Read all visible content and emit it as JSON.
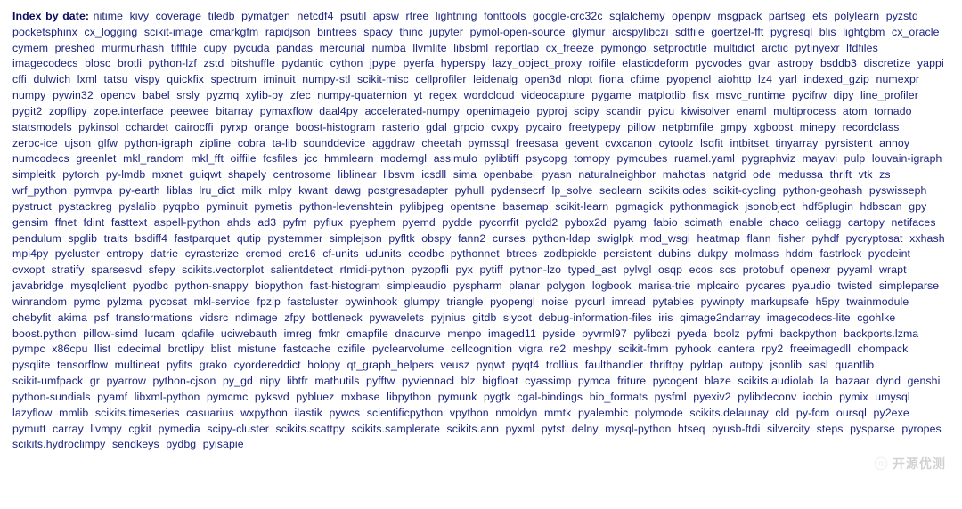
{
  "heading": "Index by date:",
  "packages": [
    "nitime",
    "kivy",
    "coverage",
    "tiledb",
    "pymatgen",
    "netcdf4",
    "psutil",
    "apsw",
    "rtree",
    "lightning",
    "fonttools",
    "google-crc32c",
    "sqlalchemy",
    "openpiv",
    "msgpack",
    "partseg",
    "ets",
    "polylearn",
    "pyzstd",
    "pocketsphinx",
    "cx_logging",
    "scikit-image",
    "cmarkgfm",
    "rapidjson",
    "bintrees",
    "spacy",
    "thinc",
    "jupyter",
    "pymol-open-source",
    "glymur",
    "aicspylibczi",
    "sdtfile",
    "goertzel-fft",
    "pygresql",
    "blis",
    "lightgbm",
    "cx_oracle",
    "cymem",
    "preshed",
    "murmurhash",
    "tifffile",
    "cupy",
    "pycuda",
    "pandas",
    "mercurial",
    "numba",
    "llvmlite",
    "libsbml",
    "reportlab",
    "cx_freeze",
    "pymongo",
    "setproctitle",
    "multidict",
    "arctic",
    "pytinyexr",
    "lfdfiles",
    "imagecodecs",
    "blosc",
    "brotli",
    "python-lzf",
    "zstd",
    "bitshuffle",
    "pydantic",
    "cython",
    "jpype",
    "pyerfa",
    "hyperspy",
    "lazy_object_proxy",
    "roifile",
    "elasticdeform",
    "pycvodes",
    "gvar",
    "astropy",
    "bsddb3",
    "discretize",
    "yappi",
    "cffi",
    "dulwich",
    "lxml",
    "tatsu",
    "vispy",
    "quickfix",
    "spectrum",
    "iminuit",
    "numpy-stl",
    "scikit-misc",
    "cellprofiler",
    "leidenalg",
    "open3d",
    "nlopt",
    "fiona",
    "cftime",
    "pyopencl",
    "aiohttp",
    "lz4",
    "yarl",
    "indexed_gzip",
    "numexpr",
    "numpy",
    "pywin32",
    "opencv",
    "babel",
    "srsly",
    "pyzmq",
    "xylib-py",
    "zfec",
    "numpy-quaternion",
    "yt",
    "regex",
    "wordcloud",
    "videocapture",
    "pygame",
    "matplotlib",
    "fisx",
    "msvc_runtime",
    "pycifrw",
    "dipy",
    "line_profiler",
    "pygit2",
    "zopflipy",
    "zope.interface",
    "peewee",
    "bitarray",
    "pymaxflow",
    "daal4py",
    "accelerated-numpy",
    "openimageio",
    "pyproj",
    "scipy",
    "scandir",
    "pyicu",
    "kiwisolver",
    "enaml",
    "multiprocess",
    "atom",
    "tornado",
    "statsmodels",
    "pykinsol",
    "cchardet",
    "cairocffi",
    "pyrxp",
    "orange",
    "boost-histogram",
    "rasterio",
    "gdal",
    "grpcio",
    "cvxpy",
    "pycairo",
    "freetypepy",
    "pillow",
    "netpbmfile",
    "gmpy",
    "xgboost",
    "minepy",
    "recordclass",
    "zeroc-ice",
    "ujson",
    "glfw",
    "python-igraph",
    "zipline",
    "cobra",
    "ta-lib",
    "sounddevice",
    "aggdraw",
    "cheetah",
    "pymssql",
    "freesasa",
    "gevent",
    "cvxcanon",
    "cytoolz",
    "lsqfit",
    "intbitset",
    "tinyarray",
    "pyrsistent",
    "annoy",
    "numcodecs",
    "greenlet",
    "mkl_random",
    "mkl_fft",
    "oiffile",
    "fcsfiles",
    "jcc",
    "hmmlearn",
    "moderngl",
    "assimulo",
    "pylibtiff",
    "psycopg",
    "tomopy",
    "pymcubes",
    "ruamel.yaml",
    "pygraphviz",
    "mayavi",
    "pulp",
    "louvain-igraph",
    "simpleitk",
    "pytorch",
    "py-lmdb",
    "mxnet",
    "guiqwt",
    "shapely",
    "centrosome",
    "liblinear",
    "libsvm",
    "icsdll",
    "sima",
    "openbabel",
    "pyasn",
    "naturalneighbor",
    "mahotas",
    "natgrid",
    "ode",
    "medussa",
    "thrift",
    "vtk",
    "zs",
    "wrf_python",
    "pymvpa",
    "py-earth",
    "liblas",
    "lru_dict",
    "milk",
    "mlpy",
    "kwant",
    "dawg",
    "postgresadapter",
    "pyhull",
    "pydensecrf",
    "lp_solve",
    "seqlearn",
    "scikits.odes",
    "scikit-cycling",
    "python-geohash",
    "pyswisseph",
    "pystruct",
    "pystackreg",
    "pyslalib",
    "pyqpbo",
    "pyminuit",
    "pymetis",
    "python-levenshtein",
    "pylibjpeg",
    "opentsne",
    "basemap",
    "scikit-learn",
    "pgmagick",
    "pythonmagick",
    "jsonobject",
    "hdf5plugin",
    "hdbscan",
    "gpy",
    "gensim",
    "ffnet",
    "fdint",
    "fasttext",
    "aspell-python",
    "ahds",
    "ad3",
    "pyfm",
    "pyflux",
    "pyephem",
    "pyemd",
    "pydde",
    "pycorrfit",
    "pycld2",
    "pybox2d",
    "pyamg",
    "fabio",
    "scimath",
    "enable",
    "chaco",
    "celiagg",
    "cartopy",
    "netifaces",
    "pendulum",
    "spglib",
    "traits",
    "bsdiff4",
    "fastparquet",
    "qutip",
    "pystemmer",
    "simplejson",
    "pyfltk",
    "obspy",
    "fann2",
    "curses",
    "python-ldap",
    "swiglpk",
    "mod_wsgi",
    "heatmap",
    "flann",
    "fisher",
    "pyhdf",
    "pycryptosat",
    "xxhash",
    "mpi4py",
    "pycluster",
    "entropy",
    "datrie",
    "cyrasterize",
    "crcmod",
    "crc16",
    "cf-units",
    "udunits",
    "ceodbc",
    "pythonnet",
    "btrees",
    "zodbpickle",
    "persistent",
    "dubins",
    "dukpy",
    "molmass",
    "hddm",
    "fastrlock",
    "pyodeint",
    "cvxopt",
    "stratify",
    "sparsesvd",
    "sfepy",
    "scikits.vectorplot",
    "salientdetect",
    "rtmidi-python",
    "pyzopfli",
    "pyx",
    "pytiff",
    "python-lzo",
    "typed_ast",
    "pylvgl",
    "osqp",
    "ecos",
    "scs",
    "protobuf",
    "openexr",
    "pyyaml",
    "wrapt",
    "javabridge",
    "mysqlclient",
    "pyodbc",
    "python-snappy",
    "biopython",
    "fast-histogram",
    "simpleaudio",
    "pyspharm",
    "planar",
    "polygon",
    "logbook",
    "marisa-trie",
    "mplcairo",
    "pycares",
    "pyaudio",
    "twisted",
    "simpleparse",
    "winrandom",
    "pymc",
    "pylzma",
    "pycosat",
    "mkl-service",
    "fpzip",
    "fastcluster",
    "pywinhook",
    "glumpy",
    "triangle",
    "pyopengl",
    "noise",
    "pycurl",
    "imread",
    "pytables",
    "pywinpty",
    "markupsafe",
    "h5py",
    "twainmodule",
    "chebyfit",
    "akima",
    "psf",
    "transformations",
    "vidsrc",
    "ndimage",
    "zfpy",
    "bottleneck",
    "pywavelets",
    "pyjnius",
    "gitdb",
    "slycot",
    "debug-information-files",
    "iris",
    "qimage2ndarray",
    "imagecodecs-lite",
    "cgohlke",
    "boost.python",
    "pillow-simd",
    "lucam",
    "qdafile",
    "uciwebauth",
    "imreg",
    "fmkr",
    "cmapfile",
    "dnacurve",
    "menpo",
    "imaged11",
    "pyside",
    "pyvrml97",
    "pylibczi",
    "pyeda",
    "bcolz",
    "pyfmi",
    "backpython",
    "backports.lzma",
    "pympc",
    "x86cpu",
    "llist",
    "cdecimal",
    "brotlipy",
    "blist",
    "mistune",
    "fastcache",
    "czifile",
    "pyclearvolume",
    "cellcognition",
    "vigra",
    "re2",
    "meshpy",
    "scikit-fmm",
    "pyhook",
    "cantera",
    "rpy2",
    "freeimagedll",
    "chompack",
    "pysqlite",
    "tensorflow",
    "multineat",
    "pyfits",
    "grako",
    "cyordereddict",
    "holopy",
    "qt_graph_helpers",
    "veusz",
    "pyqwt",
    "pyqt4",
    "trollius",
    "faulthandler",
    "thriftpy",
    "pyldap",
    "autopy",
    "jsonlib",
    "sasl",
    "quantlib",
    "scikit-umfpack",
    "gr",
    "pyarrow",
    "python-cjson",
    "py_gd",
    "nipy",
    "libtfr",
    "mathutils",
    "pyfftw",
    "pyviennacl",
    "blz",
    "bigfloat",
    "cyassimp",
    "pymca",
    "friture",
    "pycogent",
    "blaze",
    "scikits.audiolab",
    "la",
    "bazaar",
    "dynd",
    "genshi",
    "python-sundials",
    "pyamf",
    "libxml-python",
    "pymcmc",
    "pyksvd",
    "pybluez",
    "mxbase",
    "libpython",
    "pymunk",
    "pygtk",
    "cgal-bindings",
    "bio_formats",
    "pysfml",
    "pyexiv2",
    "pylibdeconv",
    "iocbio",
    "pymix",
    "umysql",
    "lazyflow",
    "mmlib",
    "scikits.timeseries",
    "casuarius",
    "wxpython",
    "ilastik",
    "pywcs",
    "scientificpython",
    "vpython",
    "nmoldyn",
    "mmtk",
    "pyalembic",
    "polymode",
    "scikits.delaunay",
    "cld",
    "py-fcm",
    "oursql",
    "py2exe",
    "pymutt",
    "carray",
    "llvmpy",
    "cgkit",
    "pymedia",
    "scipy-cluster",
    "scikits.scattpy",
    "scikits.samplerate",
    "scikits.ann",
    "pyxml",
    "pytst",
    "delny",
    "mysql-python",
    "htseq",
    "pyusb-ftdi",
    "silvercity",
    "steps",
    "pysparse",
    "pyropes",
    "scikits.hydroclimpy",
    "sendkeys",
    "pydbg",
    "pyisapie"
  ],
  "watermark": "开源优测"
}
